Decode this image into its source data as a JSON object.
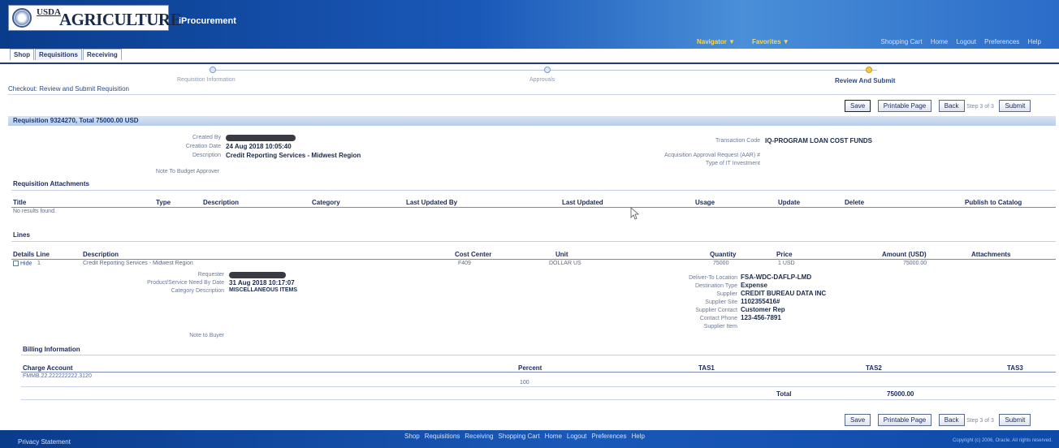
{
  "header": {
    "usda": "USDA",
    "agency": "AGRICULTURE",
    "app_title": "iProcurement",
    "navigator": "Navigator ▼",
    "favorites": "Favorites ▼",
    "global_links": [
      "Shopping Cart",
      "Home",
      "Logout",
      "Preferences",
      "Help"
    ]
  },
  "tabs": [
    "Shop",
    "Requisitions",
    "Receiving"
  ],
  "train": {
    "steps": [
      "Requisition Information",
      "Approvals",
      "Review And Submit"
    ]
  },
  "page_title": "Checkout: Review and Submit Requisition",
  "actions": {
    "save": "Save",
    "printable": "Printable Page",
    "back": "Back",
    "step": "Step 3 of 3",
    "submit": "Submit"
  },
  "requisition": {
    "bar": "Requisition 9324270, Total 75000.00 USD",
    "created_by_label": "Created By",
    "creation_date_label": "Creation Date",
    "creation_date": "24 Aug 2018 10:05:40",
    "description_label": "Description",
    "description": "Credit Reporting Services - Midwest Region",
    "note_budget": "Note To Budget Approver",
    "transaction_code_label": "Transaction Code",
    "transaction_code": "IQ-PROGRAM LOAN COST FUNDS",
    "aar_label": "Acquisition Approval Request (AAR) #",
    "it_label": "Type of IT Investment"
  },
  "attachments": {
    "heading": "Requisition Attachments",
    "columns": [
      "Title",
      "Type",
      "Description",
      "Category",
      "Last Updated By",
      "Last Updated",
      "Usage",
      "Update",
      "Delete",
      "Publish to Catalog"
    ],
    "empty": "No results found."
  },
  "lines": {
    "heading": "Lines",
    "columns": [
      "Details Line",
      "Description",
      "Cost Center",
      "Unit",
      "Quantity",
      "Price",
      "Amount (USD)",
      "Attachments"
    ],
    "row": {
      "details": "Hide",
      "line": "1",
      "description": "Credit Reporting Services - Midwest Region",
      "cost_center": "F409",
      "unit": "DOLLAR US",
      "quantity": "75000",
      "price": "1 USD",
      "amount": "75000.00"
    },
    "details_left": {
      "requester_label": "Requester",
      "need_by_label": "Product/Service Need By Date",
      "need_by": "31 Aug 2018 10:17:07",
      "category_label": "Category Description",
      "category": "MISCELLANEOUS ITEMS",
      "note_buyer": "Note to Buyer"
    },
    "details_right": [
      {
        "label": "Deliver-To Location",
        "value": "FSA-WDC-DAFLP-LMD"
      },
      {
        "label": "Destination Type",
        "value": "Expense"
      },
      {
        "label": "Supplier",
        "value": "CREDIT BUREAU DATA INC"
      },
      {
        "label": "Supplier Site",
        "value": "1102355416#"
      },
      {
        "label": "Supplier Contact",
        "value": "Customer Rep"
      },
      {
        "label": "Contact Phone",
        "value": "123-456-7891"
      },
      {
        "label": "Supplier Item",
        "value": ""
      }
    ]
  },
  "billing": {
    "heading": "Billing Information",
    "columns": [
      "Charge Account",
      "Percent",
      "TAS1",
      "TAS2",
      "TAS3"
    ],
    "account": "FMMB.22.222222222.3120",
    "percent": "100",
    "total_label": "Total",
    "total": "75000.00"
  },
  "footer": {
    "privacy": "Privacy Statement",
    "links": [
      "Shop",
      "Requisitions",
      "Receiving",
      "Shopping Cart",
      "Home",
      "Logout",
      "Preferences",
      "Help"
    ],
    "copyright": "Copyright (c) 2006, Oracle. All rights reserved."
  }
}
